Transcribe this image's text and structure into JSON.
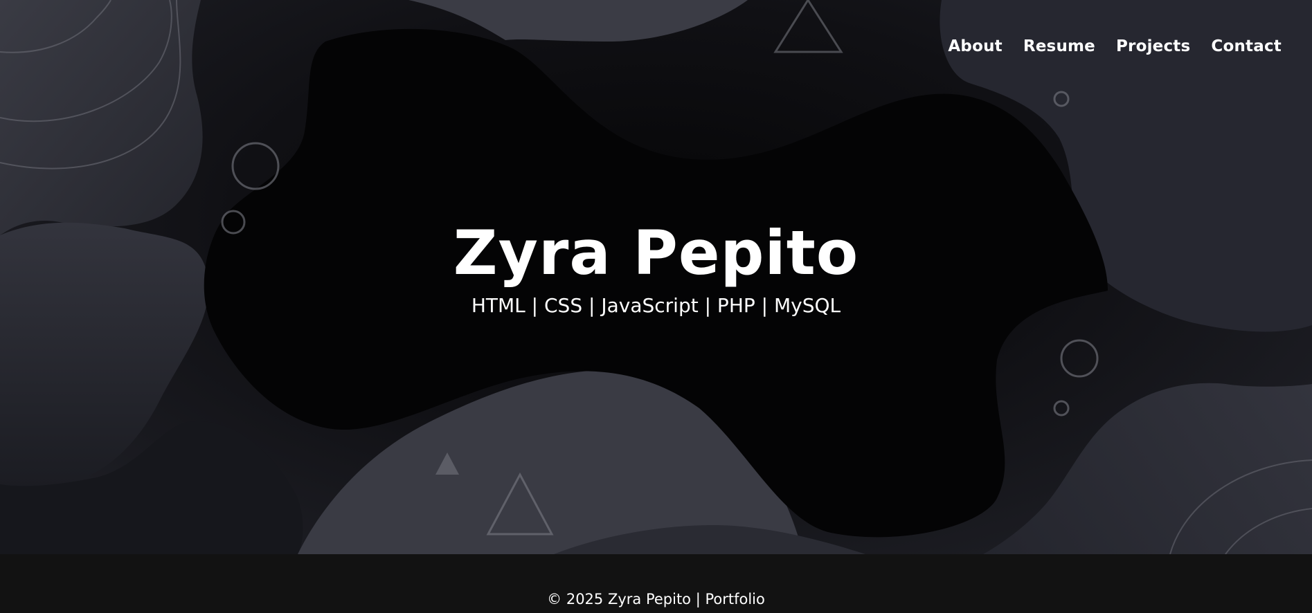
{
  "nav": {
    "items": [
      {
        "label": "About"
      },
      {
        "label": "Resume"
      },
      {
        "label": "Projects"
      },
      {
        "label": "Contact"
      }
    ]
  },
  "hero": {
    "title": "Zyra Pepito",
    "subtitle": "HTML | CSS | JavaScript | PHP | MySQL"
  },
  "footer": {
    "text": "© 2025 Zyra Pepito | Portfolio"
  },
  "colors": {
    "footer_bg": "#121212",
    "text": "#ffffff",
    "blob_dark": "#020203",
    "blob_light": "#2c2d35"
  }
}
